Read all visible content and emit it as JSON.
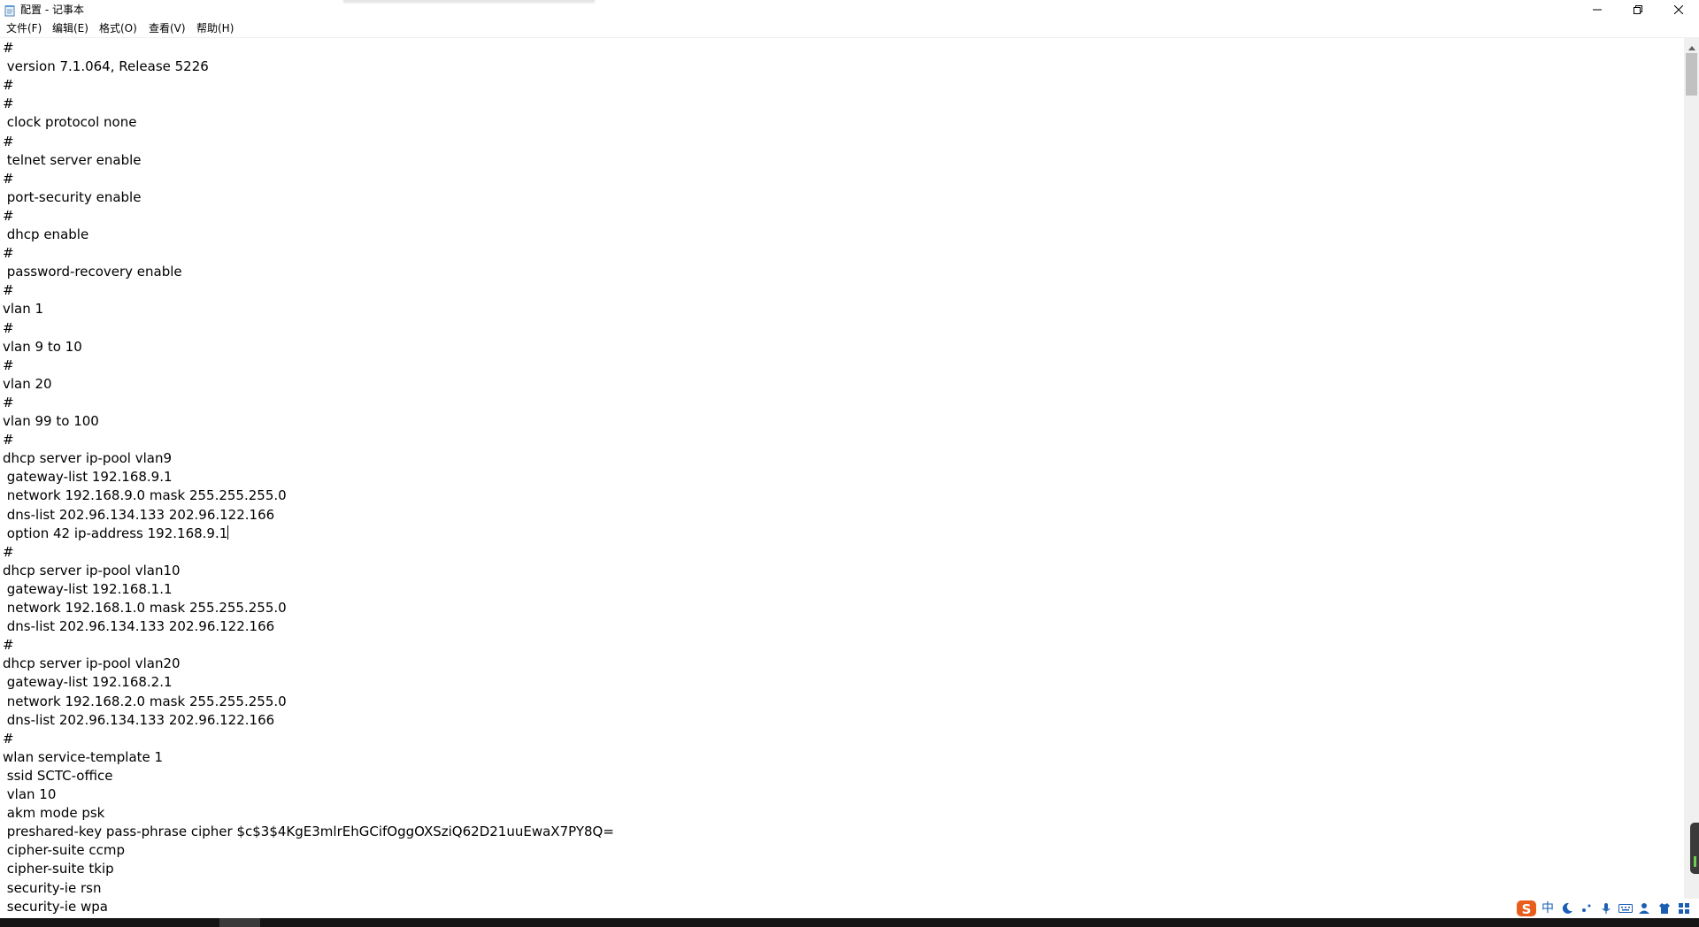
{
  "window": {
    "title": "配置 - 记事本",
    "minimize_icon": "minimize-icon",
    "restore_icon": "restore-icon",
    "close_icon": "close-icon",
    "app_icon": "notepad-icon"
  },
  "menu": {
    "file": "文件(F)",
    "edit": "编辑(E)",
    "format": "格式(O)",
    "view": "查看(V)",
    "help": "帮助(H)"
  },
  "editor": {
    "caret_line_index": 26,
    "lines": [
      "#",
      " version 7.1.064, Release 5226",
      "#",
      "#",
      " clock protocol none",
      "#",
      " telnet server enable",
      "#",
      " port-security enable",
      "#",
      " dhcp enable",
      "#",
      " password-recovery enable",
      "#",
      "vlan 1",
      "#",
      "vlan 9 to 10",
      "#",
      "vlan 20",
      "#",
      "vlan 99 to 100",
      "#",
      "dhcp server ip-pool vlan9",
      " gateway-list 192.168.9.1",
      " network 192.168.9.0 mask 255.255.255.0",
      " dns-list 202.96.134.133 202.96.122.166",
      " option 42 ip-address 192.168.9.1",
      "#",
      "dhcp server ip-pool vlan10",
      " gateway-list 192.168.1.1",
      " network 192.168.1.0 mask 255.255.255.0",
      " dns-list 202.96.134.133 202.96.122.166",
      "#",
      "dhcp server ip-pool vlan20",
      " gateway-list 192.168.2.1",
      " network 192.168.2.0 mask 255.255.255.0",
      " dns-list 202.96.134.133 202.96.122.166",
      "#",
      "wlan service-template 1",
      " ssid SCTC-office",
      " vlan 10",
      " akm mode psk",
      " preshared-key pass-phrase cipher $c$3$4KgE3mlrEhGCifOggOXSziQ62D21uuEwaX7PY8Q=",
      " cipher-suite ccmp",
      " cipher-suite tkip",
      " security-ie rsn",
      " security-ie wpa"
    ]
  },
  "ime": {
    "logo_icon": "sogou-s-icon",
    "mode": "中",
    "items": [
      "moon-icon",
      "punctuation-icon",
      "microphone-icon",
      "keyboard-icon",
      "user-settings-icon",
      "shirt-skin-icon",
      "grid-menu-icon"
    ]
  },
  "colors": {
    "ime_logo": "#e85d1c",
    "ime_icon": "#1a5fb4",
    "taskbar": "#151515"
  }
}
